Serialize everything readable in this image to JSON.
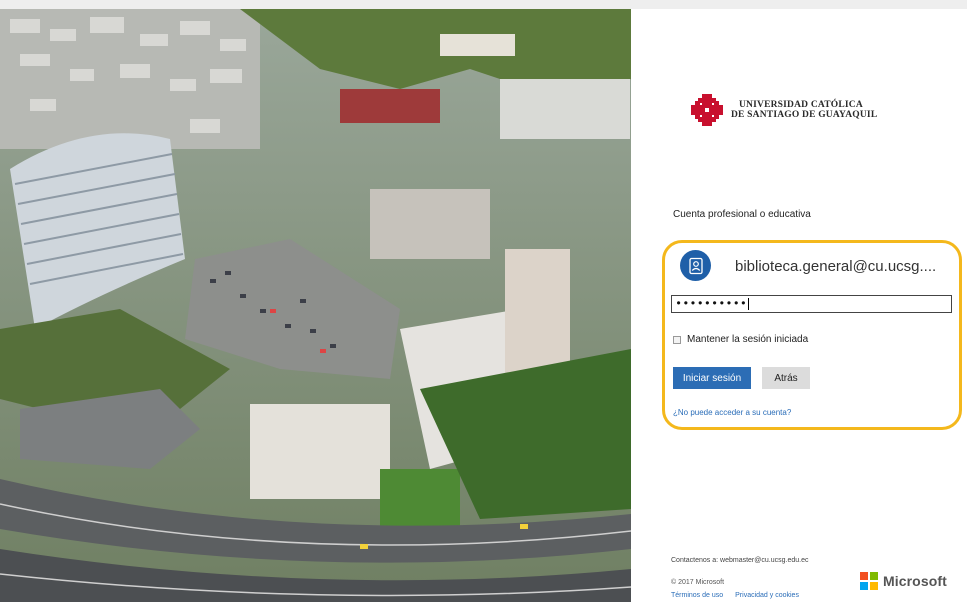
{
  "logo": {
    "line1": "UNIVERSIDAD CATÓLICA",
    "line2": "DE SANTIAGO DE GUAYAQUIL",
    "color": "#c8102e"
  },
  "login": {
    "account_type": "Cuenta profesional o educativa",
    "user_email": "biblioteca.general@cu.ucsg....",
    "password_mask": "••••••••••",
    "keep_signed_in_label": "Mantener la sesión iniciada",
    "keep_signed_in_checked": false,
    "signin_label": "Iniciar sesión",
    "back_label": "Atrás",
    "cant_access_label": "¿No puede acceder a su cuenta?"
  },
  "footer": {
    "contact": "Contactenos a: webmaster@cu.ucsg.edu.ec",
    "copyright": "© 2017 Microsoft",
    "terms_label": "Términos de uso",
    "privacy_label": "Privacidad y cookies",
    "brand": "Microsoft"
  },
  "colors": {
    "primary_button": "#2c6db5",
    "link": "#2a6db8",
    "highlight": "#f4b81c",
    "ms_red": "#f25022",
    "ms_green": "#7fba00",
    "ms_blue": "#00a4ef",
    "ms_yellow": "#ffb900"
  }
}
